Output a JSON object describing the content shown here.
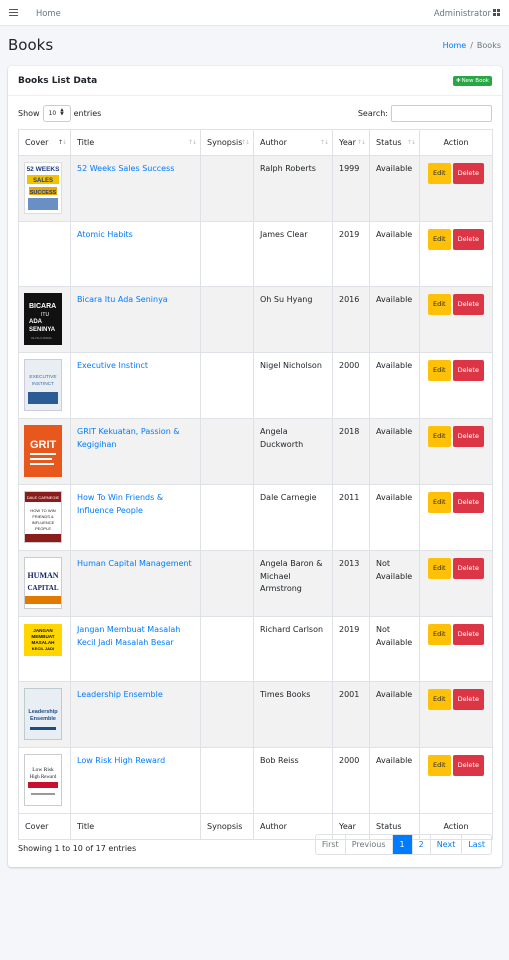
{
  "topbar": {
    "home": "Home",
    "user": "Administrator"
  },
  "header": {
    "title": "Books",
    "breadcrumb_home": "Home",
    "breadcrumb_sep": "/",
    "breadcrumb_current": "Books"
  },
  "card": {
    "title": "Books List Data",
    "new_button": "New Book"
  },
  "controls": {
    "show_label": "Show",
    "entries_value": "10",
    "entries_label": "entries",
    "search_label": "Search:"
  },
  "table": {
    "columns": [
      "Cover",
      "Title",
      "Synopsis",
      "Author",
      "Year",
      "Status",
      "Action"
    ],
    "rows": [
      {
        "title": "52 Weeks Sales Success",
        "synopsis": "",
        "author": "Ralph Roberts",
        "year": "1999",
        "status": "Available",
        "cover_text": "52 WEEKS SALES SUCCESS"
      },
      {
        "title": "Atomic Habits",
        "synopsis": "",
        "author": "James Clear",
        "year": "2019",
        "status": "Available",
        "cover_text": ""
      },
      {
        "title": "Bicara Itu Ada Seninya",
        "synopsis": "",
        "author": "Oh Su Hyang",
        "year": "2016",
        "status": "Available",
        "cover_text": "BICARA ITU ADA SENINYA"
      },
      {
        "title": "Executive Instinct",
        "synopsis": "",
        "author": "Nigel Nicholson",
        "year": "2000",
        "status": "Available",
        "cover_text": "EXECUTIVE INSTINCT"
      },
      {
        "title": "GRIT Kekuatan, Passion & Kegigihan",
        "synopsis": "",
        "author": "Angela Duckworth",
        "year": "2018",
        "status": "Available",
        "cover_text": "GRIT"
      },
      {
        "title": "How To Win Friends & Influence People",
        "synopsis": "",
        "author": "Dale Carnegie",
        "year": "2011",
        "status": "Available",
        "cover_text": "DALE CARNEGIE HOW TO WIN FRIENDS & INFLUENCE PEOPLE"
      },
      {
        "title": "Human Capital Management",
        "synopsis": "",
        "author": "Angela Baron & Michael Armstrong",
        "year": "2013",
        "status": "Not Available",
        "cover_text": "HUMAN CAPITAL"
      },
      {
        "title": "Jangan Membuat Masalah Kecil Jadi Masalah Besar",
        "synopsis": "",
        "author": "Richard Carlson",
        "year": "2019",
        "status": "Not Available",
        "cover_text": "JANGAN MEMBUAT MASALAH KECIL JADI MASALAH"
      },
      {
        "title": "Leadership Ensemble",
        "synopsis": "",
        "author": "Times Books",
        "year": "2001",
        "status": "Available",
        "cover_text": "Leadership Ensemble"
      },
      {
        "title": "Low Risk High Reward",
        "synopsis": "",
        "author": "Bob Reiss",
        "year": "2000",
        "status": "Available",
        "cover_text": "Low Risk High Reward"
      }
    ],
    "edit_label": "Edit",
    "delete_label": "Delete"
  },
  "footer": {
    "info": "Showing 1 to 10 of 17 entries",
    "pagination": {
      "first": "First",
      "previous": "Previous",
      "page1": "1",
      "page2": "2",
      "next": "Next",
      "last": "Last"
    }
  },
  "colors": {
    "primary": "#007bff",
    "success": "#28a745",
    "warning": "#ffc107",
    "danger": "#dc3545"
  }
}
